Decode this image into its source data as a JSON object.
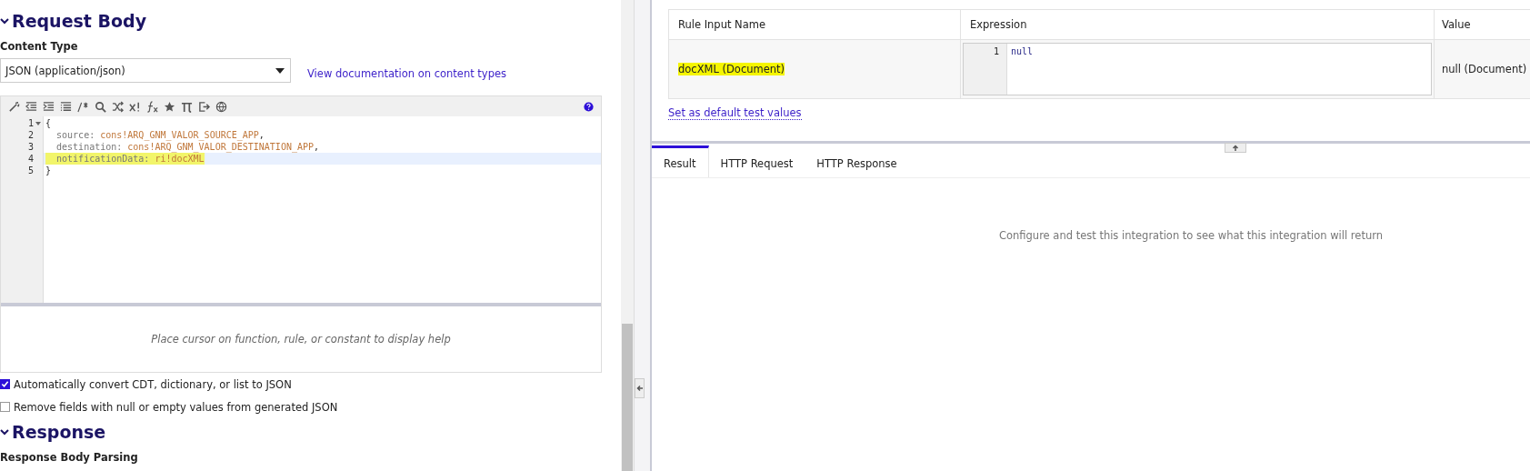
{
  "request_body": {
    "heading": "Request Body",
    "expanded": true,
    "content_type": {
      "label": "Content Type",
      "value": "JSON (application/json)",
      "link": "View documentation on content types"
    },
    "editor": {
      "lines": [
        {
          "number": "1",
          "foldable": true,
          "active": false,
          "highlighted": false,
          "parts": [
            {
              "text": "{",
              "kind": "punct"
            }
          ]
        },
        {
          "number": "2",
          "active": false,
          "highlighted": false,
          "parts": [
            {
              "text": "  source: ",
              "kind": "key"
            },
            {
              "text": "cons!ARQ_GNM_VALOR_SOURCE_APP",
              "kind": "value"
            },
            {
              "text": ",",
              "kind": "punct"
            }
          ]
        },
        {
          "number": "3",
          "active": false,
          "highlighted": false,
          "parts": [
            {
              "text": "  destination: ",
              "kind": "key"
            },
            {
              "text": "cons!ARQ_GNM_VALOR_DESTINATION_APP",
              "kind": "value"
            },
            {
              "text": ",",
              "kind": "punct"
            }
          ]
        },
        {
          "number": "4",
          "active": true,
          "highlighted": true,
          "parts": [
            {
              "text": "  notificationData: ",
              "kind": "key"
            },
            {
              "text": "ri!docXML",
              "kind": "value"
            }
          ]
        },
        {
          "number": "5",
          "active": false,
          "highlighted": false,
          "parts": [
            {
              "text": "}",
              "kind": "punct"
            }
          ]
        }
      ],
      "help": "Place cursor on function, rule, or constant to display help"
    },
    "options": [
      {
        "label": "Automatically convert CDT, dictionary, or list to JSON",
        "checked": true
      },
      {
        "label": "Remove fields with null or empty values from generated JSON",
        "checked": false
      }
    ]
  },
  "response": {
    "heading": "Response",
    "expanded": true,
    "subheading": "Response Body Parsing"
  },
  "rule_inputs": {
    "columns": [
      "Rule Input Name",
      "Expression",
      "Value"
    ],
    "rows": [
      {
        "name": "docXML (Document)",
        "highlighted": true,
        "expression_lines": [
          {
            "number": "1",
            "text": "null"
          }
        ],
        "value": "null (Document)"
      }
    ],
    "link": "Set as default test values"
  },
  "result_tabs": [
    {
      "label": "Result",
      "selected": true
    },
    {
      "label": "HTTP Request",
      "selected": false
    },
    {
      "label": "HTTP Response",
      "selected": false
    }
  ],
  "result_message": "Configure and test this integration to see what this integration will return"
}
